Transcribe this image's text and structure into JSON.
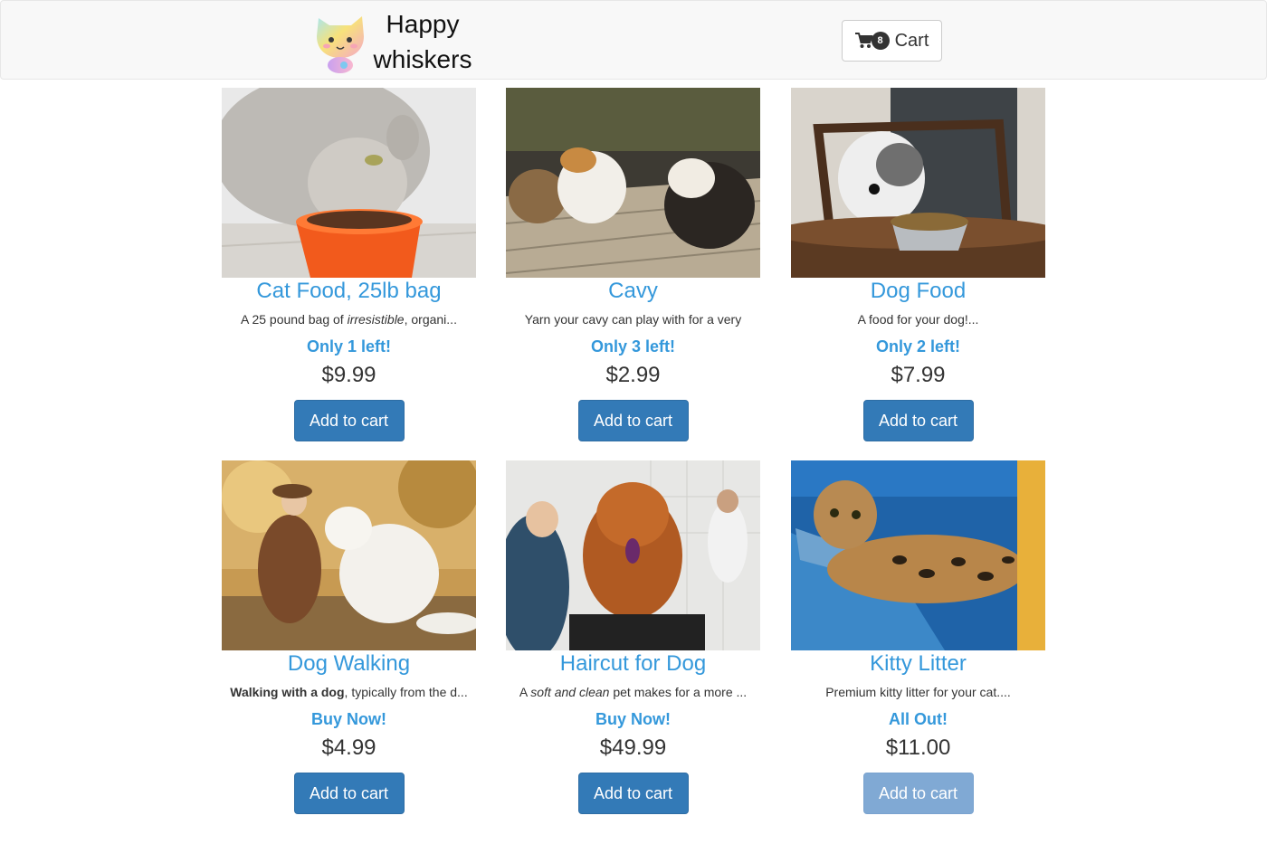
{
  "header": {
    "brand_line1": "Happy",
    "brand_line2": "whiskers",
    "logo_icon": "kitten-logo-icon",
    "cart_icon": "shopping-cart-icon",
    "cart_count": "8",
    "cart_label": "Cart"
  },
  "products": [
    {
      "title": "Cat Food, 25lb bag",
      "desc_before": "A 25 pound bag of ",
      "desc_italic": "irresistible",
      "desc_after": ", organi...",
      "stock": "Only 1 left!",
      "price": "$9.99",
      "button": "Add to cart",
      "image": "cat-eating-from-orange-bowl"
    },
    {
      "title": "Cavy",
      "desc": "Yarn your cavy can play with for a very",
      "stock": "Only 3 left!",
      "price": "$2.99",
      "button": "Add to cart",
      "image": "guinea-pigs-on-wooden-deck"
    },
    {
      "title": "Dog Food",
      "desc": "A food for your dog!...",
      "stock": "Only 2 left!",
      "price": "$7.99",
      "button": "Add to cart",
      "image": "dog-at-table-with-food-bowl"
    },
    {
      "title": "Dog Walking",
      "desc_bold": "Walking with a dog",
      "desc_after": ", typically from the d...",
      "stock": "Buy Now!",
      "price": "$4.99",
      "button": "Add to cart",
      "image": "woman-with-white-dog-in-autumn-park"
    },
    {
      "title": "Haircut for Dog",
      "desc_before": "A ",
      "desc_italic": "soft and clean",
      "desc_after": " pet makes for a more ...",
      "stock": "Buy Now!",
      "price": "$49.99",
      "button": "Add to cart",
      "image": "groomer-with-chow-chow-dog"
    },
    {
      "title": "Kitty Litter",
      "desc": "Premium kitty litter for your cat....",
      "stock": "All Out!",
      "price": "$11.00",
      "button": "Add to cart",
      "button_disabled": true,
      "image": "bengal-cat-on-blue-chair"
    }
  ],
  "colors": {
    "accent": "#3498db",
    "button": "#337ab7",
    "button_disabled": "#80a9d4",
    "navbar": "#f8f8f8"
  }
}
